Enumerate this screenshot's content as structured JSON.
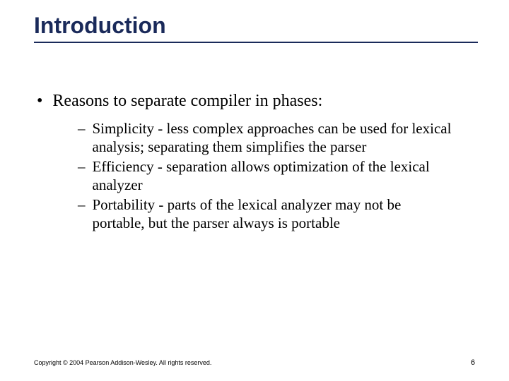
{
  "title": "Introduction",
  "main_bullet": "Reasons to separate compiler in phases:",
  "sub_items": [
    "Simplicity - less complex approaches can be used for lexical analysis; separating them simplifies the parser",
    "Efficiency - separation allows optimization of the lexical analyzer",
    "Portability - parts of the lexical analyzer may not be portable, but the parser always is portable"
  ],
  "copyright": "Copyright © 2004 Pearson Addison-Wesley. All rights reserved.",
  "page_number": "6"
}
